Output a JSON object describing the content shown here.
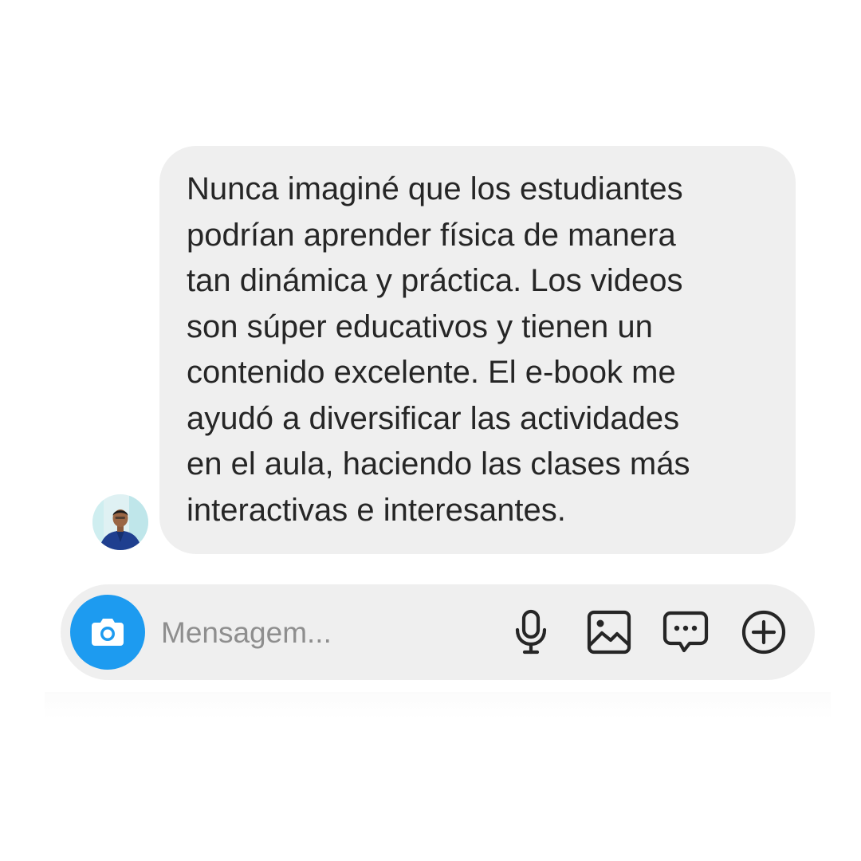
{
  "message": {
    "lines": [
      "Nunca imaginé que los estudiantes",
      "podrían aprender física de manera",
      "tan dinámica y práctica. Los videos",
      "son súper educativos y tienen un",
      "contenido excelente. El e-book me",
      "ayudó a diversificar las actividades",
      "en el aula, haciendo las clases más",
      "interactivas e interesantes."
    ]
  },
  "composer": {
    "placeholder": "Mensagem...",
    "icons": [
      "camera-icon",
      "microphone-icon",
      "image-icon",
      "sticker-message-icon",
      "plus-circle-icon"
    ]
  },
  "colors": {
    "accent": "#1d9bf0",
    "bubble": "#efefef",
    "text": "#262626",
    "placeholder": "#8e8e8e"
  }
}
